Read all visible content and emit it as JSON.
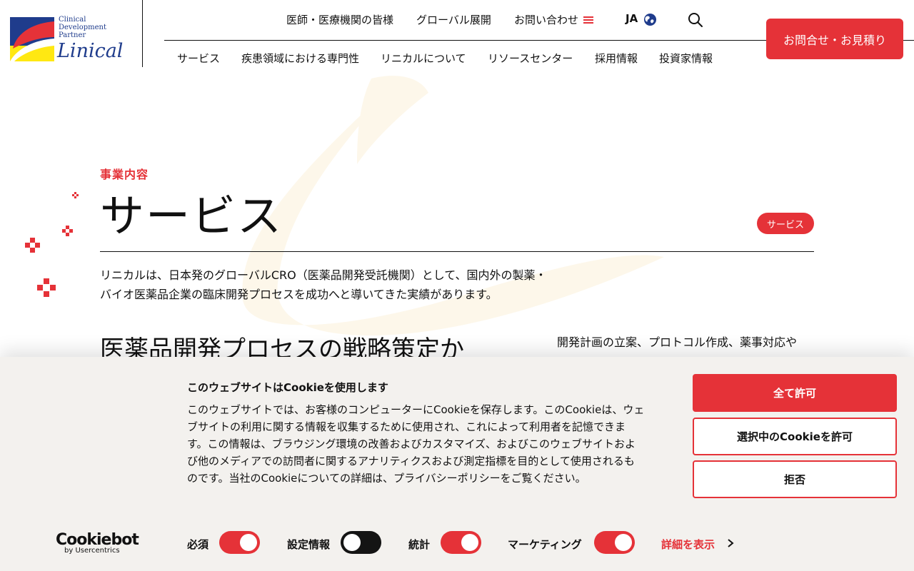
{
  "logo": {
    "tagline_lines": [
      "Clinical",
      "Development",
      "Partner"
    ],
    "name": "Linical"
  },
  "top_nav": {
    "items": [
      "医師・医療機関の皆様",
      "グローバル展開",
      "お問い合わせ"
    ],
    "language": "JA"
  },
  "main_nav": {
    "items": [
      "サービス",
      "疾患領域における専門性",
      "リニカルについて",
      "リソースセンター",
      "採用情報",
      "投資家情報"
    ]
  },
  "cta": {
    "label": "お問合せ・お見積り"
  },
  "hero": {
    "eyebrow": "事業内容",
    "title": "サービス",
    "breadcrumb": "サービス",
    "intro_lines": [
      "リニカルは、日本発のグローバルCRO（医薬品開発受託機関）として、国内外の製薬・",
      "バイオ医薬品企業の臨床開発プロセスを成功へと導いてきた実績があります。"
    ],
    "section_heading": "医薬品開発プロセスの戦略策定か",
    "section_text": "開発計画の立案、プロトコル作成、薬事対応や"
  },
  "cookie_banner": {
    "title": "このウェブサイトはCookieを使用します",
    "body_lines": [
      "このウェブサイトでは、お客様のコンピューターにCookieを保存します。このCookieは、ウェ",
      "ブサイトの利用に関する情報を収集するために使用され、これによって利用者を記憶できま",
      "す。この情報は、ブラウジング環境の改善およびカスタマイズ、およびこのウェブサイトおよ",
      "び他のメディアでの訪問者に関するアナリティクスおよび測定指標を目的として使用されるも",
      "のです。当社のCookieについての詳細は、プライバシーポリシーをご覧ください。"
    ],
    "buttons": {
      "allow_all": "全て許可",
      "allow_selected": "選択中のCookieを許可",
      "deny": "拒否"
    },
    "provider": {
      "name": "Cookiebot",
      "by": "by Usercentrics"
    },
    "toggles": [
      {
        "label": "必須",
        "on": true
      },
      {
        "label": "設定情報",
        "on": false
      },
      {
        "label": "統計",
        "on": true
      },
      {
        "label": "マーケティング",
        "on": true
      }
    ],
    "details_link": "詳細を表示"
  },
  "colors": {
    "accent": "#e53238",
    "brand_blue": "#1f3c8c",
    "brand_yellow": "#ffe812",
    "banner_bg": "#f3f1ee"
  }
}
